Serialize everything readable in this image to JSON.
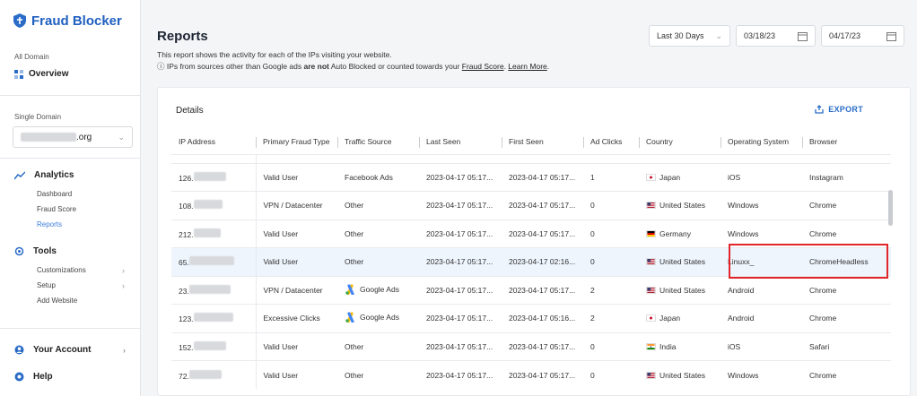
{
  "app": {
    "logo_text": "Fraud Blocker"
  },
  "sidebar": {
    "all_domain_label": "All Domain",
    "overview_label": "Overview",
    "single_domain_label": "Single Domain",
    "domain_suffix": ".org",
    "analytics_label": "Analytics",
    "analytics_items": [
      "Dashboard",
      "Fraud Score",
      "Reports"
    ],
    "tools_label": "Tools",
    "tools_items": [
      "Customizations",
      "Setup",
      "Add Website"
    ],
    "your_account_label": "Your Account",
    "help_label": "Help"
  },
  "header": {
    "title": "Reports",
    "description": "This report shows the activity for each of the IPs visiting your website.",
    "note_prefix": "IPs from sources other than Google ads",
    "note_bold": "are not",
    "note_mid": "Auto Blocked or counted towards your",
    "note_link1": "Fraud Score",
    "note_link2": "Learn More",
    "range_select": "Last 30 Days",
    "date_from": "03/18/23",
    "date_to": "04/17/23"
  },
  "card": {
    "title": "Details",
    "export_label": "EXPORT"
  },
  "table": {
    "columns": [
      "IP Address",
      "Primary Fraud Type",
      "Traffic Source",
      "Last Seen",
      "First Seen",
      "Ad Clicks",
      "Country",
      "Operating System",
      "Browser"
    ],
    "rows": [
      {
        "ip": "126.",
        "type": "Valid User",
        "source": "Facebook Ads",
        "last": "2023-04-17 05:17...",
        "first": "2023-04-17 05:17...",
        "clicks": "1",
        "country": "Japan",
        "flag": "jp",
        "os": "iOS",
        "browser": "Instagram"
      },
      {
        "ip": "108.",
        "type": "VPN / Datacenter",
        "source": "Other",
        "last": "2023-04-17 05:17...",
        "first": "2023-04-17 05:17...",
        "clicks": "0",
        "country": "United States",
        "flag": "us",
        "os": "Windows",
        "browser": "Chrome"
      },
      {
        "ip": "212.",
        "type": "Valid User",
        "source": "Other",
        "last": "2023-04-17 05:17...",
        "first": "2023-04-17 05:17...",
        "clicks": "0",
        "country": "Germany",
        "flag": "de",
        "os": "Windows",
        "browser": "Chrome"
      },
      {
        "ip": "65.",
        "type": "Valid User",
        "source": "Other",
        "last": "2023-04-17 05:17...",
        "first": "2023-04-17 02:16...",
        "clicks": "0",
        "country": "United States",
        "flag": "us",
        "os": "Linuxx_",
        "browser": "ChromeHeadless"
      },
      {
        "ip": "23.",
        "type": "VPN / Datacenter",
        "source": "Google Ads",
        "last": "2023-04-17 05:17...",
        "first": "2023-04-17 05:17...",
        "clicks": "2",
        "country": "United States",
        "flag": "us",
        "os": "Android",
        "browser": "Chrome"
      },
      {
        "ip": "123.",
        "type": "Excessive Clicks",
        "source": "Google Ads",
        "last": "2023-04-17 05:17...",
        "first": "2023-04-17 05:16...",
        "clicks": "2",
        "country": "Japan",
        "flag": "jp",
        "os": "Android",
        "browser": "Chrome"
      },
      {
        "ip": "152.",
        "type": "Valid User",
        "source": "Other",
        "last": "2023-04-17 05:17...",
        "first": "2023-04-17 05:17...",
        "clicks": "0",
        "country": "India",
        "flag": "in",
        "os": "iOS",
        "browser": "Safari"
      },
      {
        "ip": "72.",
        "type": "Valid User",
        "source": "Other",
        "last": "2023-04-17 05:17...",
        "first": "2023-04-17 05:17...",
        "clicks": "0",
        "country": "United States",
        "flag": "us",
        "os": "Windows",
        "browser": "Chrome"
      }
    ]
  },
  "colors": {
    "accent": "#2a6cc7",
    "highlight_box": "#e0262a",
    "row_highlight": "#eef5fd"
  }
}
